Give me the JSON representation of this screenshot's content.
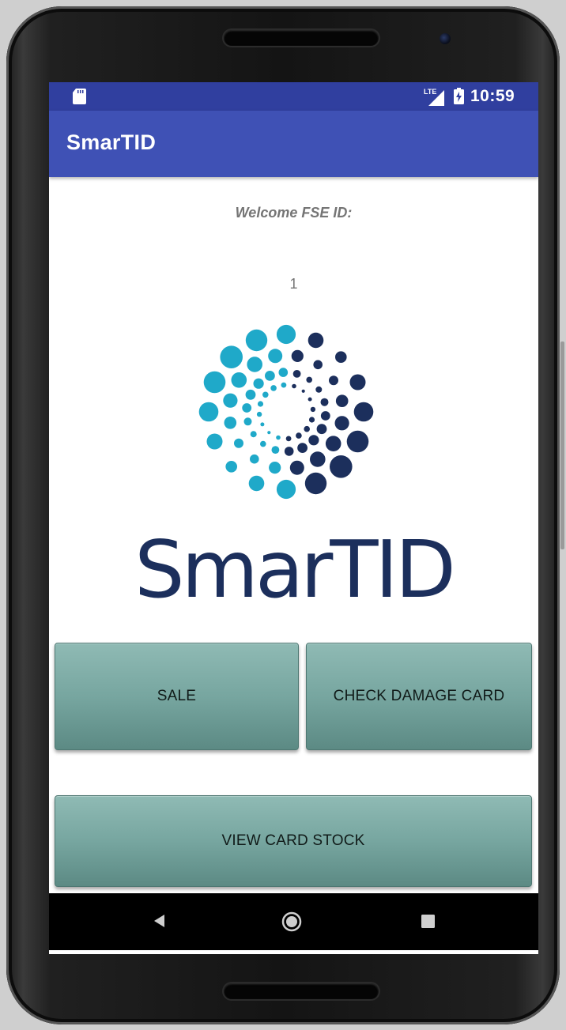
{
  "status_bar": {
    "time": "10:59",
    "icons": [
      "sd-card-icon",
      "lte-signal-icon",
      "battery-charging-icon"
    ],
    "color": "#303f9f"
  },
  "app_bar": {
    "title": "SmarTID",
    "color": "#3f51b5"
  },
  "main": {
    "welcome_label": "Welcome FSE ID:",
    "fse_id_value": "1",
    "logo_text": "SmarTID",
    "logo_colors": {
      "light": "#1fa9c9",
      "dark": "#1c2f5c"
    }
  },
  "buttons": {
    "sale_label": "SALE",
    "check_damage_label": "CHECK DAMAGE CARD",
    "view_stock_label": "VIEW CARD STOCK",
    "color": "#77a6a0"
  },
  "nav_bar": {
    "icons": [
      "back-icon",
      "home-icon",
      "recents-icon"
    ]
  }
}
